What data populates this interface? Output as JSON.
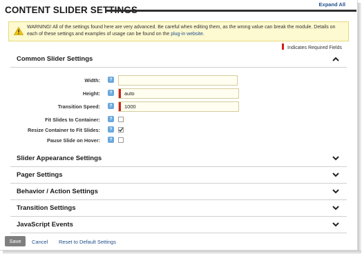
{
  "header": {
    "title": "CONTENT SLIDER SETTINGS",
    "expand_all": "Expand All"
  },
  "warning": {
    "text": "WARNING! All of the settings found here are very advanced. Be careful when editing them, as the wrong value can break the module. Details on each of these settings and examples of usage can be found on the ",
    "link": "plug-in website",
    "suffix": "."
  },
  "required_legend": "Indicates Required Fields",
  "common_section": {
    "title": "Common Slider Settings",
    "expanded": true,
    "fields": [
      {
        "label": "Width:",
        "value": "",
        "required": false
      },
      {
        "label": "Height:",
        "value": "auto",
        "required": true
      },
      {
        "label": "Transition Speed:",
        "value": "1000",
        "required": true
      }
    ],
    "checkboxes": [
      {
        "label": "Fit Slides to Container:",
        "checked": false
      },
      {
        "label": "Resize Container to Fit Slides:",
        "checked": true
      },
      {
        "label": "Pause Slide on Hover:",
        "checked": false
      }
    ],
    "help_glyph": "?"
  },
  "collapsed_sections": [
    {
      "title": "Slider Appearance Settings"
    },
    {
      "title": "Pager Settings"
    },
    {
      "title": "Behavior / Action Settings"
    },
    {
      "title": "Transition Settings"
    },
    {
      "title": "JavaScript Events"
    }
  ],
  "footer": {
    "save": "Save",
    "cancel": "Cancel",
    "reset": "Reset to Default Settings"
  },
  "icons": {
    "warning": "warning-triangle-icon",
    "help": "help-icon",
    "chevron_up": "chevron-up-icon",
    "chevron_down": "chevron-down-icon",
    "required": "required-marker"
  },
  "colors": {
    "link": "#1f4e8c",
    "required": "#d21d1d",
    "help": "#6aa8de",
    "warning_bg": "#fdf9d0",
    "field_bg": "#fffef0",
    "save_btn": "#7f7f7f"
  }
}
